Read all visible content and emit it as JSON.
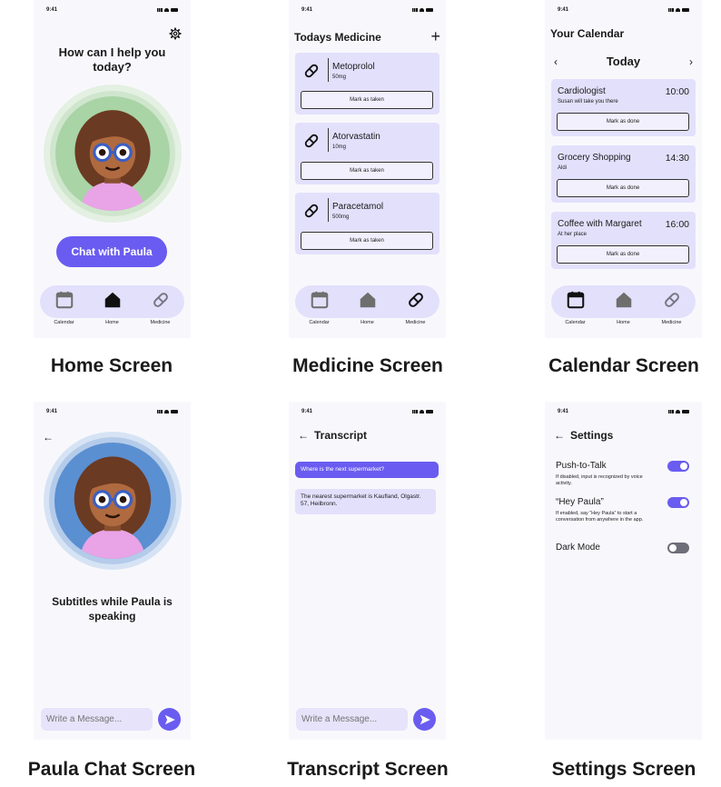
{
  "status_time": "9:41",
  "captions": {
    "home": "Home Screen",
    "medicine": "Medicine Screen",
    "calendar": "Calendar Screen",
    "chat": "Paula Chat Screen",
    "transcript": "Transcript Screen",
    "settings": "Settings Screen"
  },
  "home": {
    "title": "How can I help you today?",
    "chat_button": "Chat with Paula",
    "settings_icon": "gear-icon"
  },
  "nav": {
    "calendar": "Calendar",
    "home": "Home",
    "medicine": "Medicine"
  },
  "medicine": {
    "title": "Todays Medicine",
    "add_icon": "+",
    "items": [
      {
        "name": "Metoprolol",
        "dose": "50mg",
        "action": "Mark as taken"
      },
      {
        "name": "Atorvastatin",
        "dose": "10mg",
        "action": "Mark as taken"
      },
      {
        "name": "Paracetamol",
        "dose": "500mg",
        "action": "Mark as taken"
      }
    ]
  },
  "calendar": {
    "title": "Your Calendar",
    "day": "Today",
    "prev": "‹",
    "next": "›",
    "events": [
      {
        "title": "Cardiologist",
        "time": "10:00",
        "note": "Susan will take you there",
        "action": "Mark as done"
      },
      {
        "title": "Grocery Shopping",
        "time": "14:30",
        "note": "Aldi",
        "action": "Mark as done"
      },
      {
        "title": "Coffee with Margaret",
        "time": "16:00",
        "note": "At her place",
        "action": "Mark as done"
      }
    ]
  },
  "chat": {
    "subtitles": "Subtitles while Paula is speaking",
    "placeholder": "Write a Message..."
  },
  "transcript": {
    "title": "Transcript",
    "user_message": "Where is the next supermarket?",
    "bot_message": "The nearest supermarket is Kaufland, Olgastr. 57, Heilbronn.",
    "placeholder": "Write a Message..."
  },
  "settings": {
    "title": "Settings",
    "rows": [
      {
        "label": "Push-to-Talk",
        "desc": "If disabled, input is recognized by voice activity.",
        "on": true
      },
      {
        "label": "“Hey Paula”",
        "desc": "If enabled, say “Hey Paula” to start a conversation from anywhere in the app.",
        "on": true
      },
      {
        "label": "Dark Mode",
        "desc": "",
        "on": false
      }
    ]
  },
  "colors": {
    "accent": "#6a5cf0",
    "card": "#e3e0fc",
    "home_avatar_bg": "#a9d4a6",
    "chat_avatar_bg": "#5a8fd1"
  }
}
